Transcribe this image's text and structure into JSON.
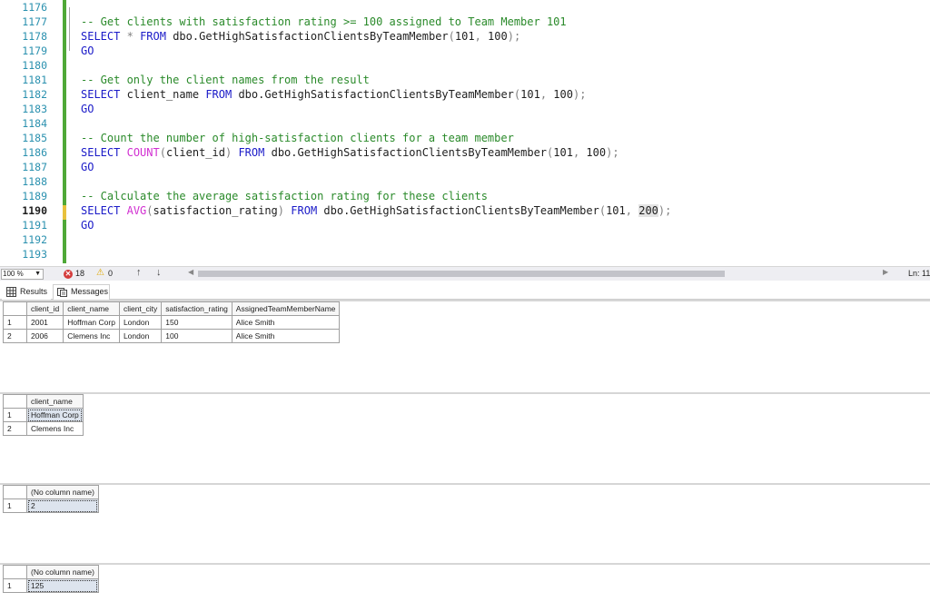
{
  "editor": {
    "lines": [
      {
        "num": "1176",
        "code": ""
      },
      {
        "num": "1177",
        "code": "-- Get clients with satisfaction rating >= 100 assigned to Team Member 101"
      },
      {
        "num": "1178",
        "code": "SELECT * FROM dbo.GetHighSatisfactionClientsByTeamMember(101, 100);"
      },
      {
        "num": "1179",
        "code": "GO"
      },
      {
        "num": "1180",
        "code": ""
      },
      {
        "num": "1181",
        "code": "-- Get only the client names from the result"
      },
      {
        "num": "1182",
        "code": "SELECT client_name FROM dbo.GetHighSatisfactionClientsByTeamMember(101, 100);"
      },
      {
        "num": "1183",
        "code": "GO"
      },
      {
        "num": "1184",
        "code": ""
      },
      {
        "num": "1185",
        "code": "-- Count the number of high-satisfaction clients for a team member"
      },
      {
        "num": "1186",
        "code": "SELECT COUNT(client_id) FROM dbo.GetHighSatisfactionClientsByTeamMember(101, 100);"
      },
      {
        "num": "1187",
        "code": "GO"
      },
      {
        "num": "1188",
        "code": ""
      },
      {
        "num": "1189",
        "code": "-- Calculate the average satisfaction rating for these clients"
      },
      {
        "num": "1190",
        "code": "SELECT AVG(satisfaction_rating) FROM dbo.GetHighSatisfactionClientsByTeamMember(101, 200);"
      },
      {
        "num": "1191",
        "code": "GO"
      },
      {
        "num": "1192",
        "code": ""
      },
      {
        "num": "1193",
        "code": ""
      }
    ],
    "current_line": "1190"
  },
  "statusbar": {
    "zoom": "100 %",
    "errors": "18",
    "warnings": "0",
    "line_indicator": "Ln: 11"
  },
  "tabs": {
    "results": "Results",
    "messages": "Messages"
  },
  "grids": [
    {
      "columns": [
        "client_id",
        "client_name",
        "client_city",
        "satisfaction_rating",
        "AssignedTeamMemberName"
      ],
      "rows": [
        [
          "1",
          "2001",
          "Hoffman Corp",
          "London",
          "150",
          "Alice Smith"
        ],
        [
          "2",
          "2006",
          "Clemens Inc",
          "London",
          "100",
          "Alice Smith"
        ]
      ]
    },
    {
      "columns": [
        "client_name"
      ],
      "rows": [
        [
          "1",
          "Hoffman Corp"
        ],
        [
          "2",
          "Clemens Inc"
        ]
      ]
    },
    {
      "columns": [
        "(No column name)"
      ],
      "rows": [
        [
          "1",
          "2"
        ]
      ]
    },
    {
      "columns": [
        "(No column name)"
      ],
      "rows": [
        [
          "1",
          "125"
        ]
      ]
    }
  ]
}
